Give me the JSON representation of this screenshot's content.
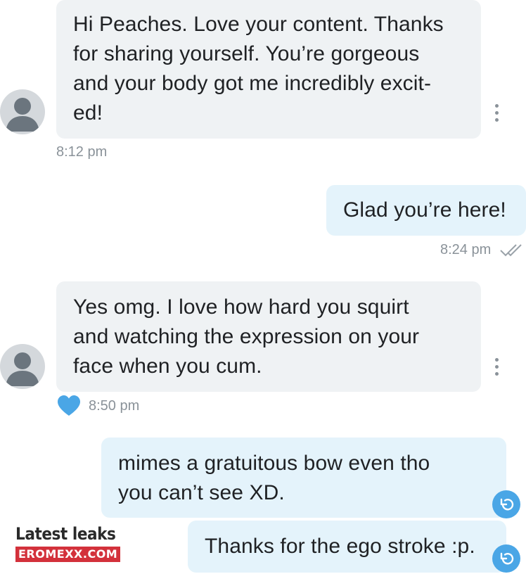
{
  "messages": [
    {
      "direction": "incoming",
      "text": "Hi Peaches. Love your content. Thanks\nfor sharing yourself. You’re gorgeous\nand your body got me incredibly excit-\ned!",
      "time": "8:12 pm"
    },
    {
      "direction": "outgoing",
      "text": "Glad you’re here!",
      "time": "8:24 pm",
      "status_icon": "double-check-icon"
    },
    {
      "direction": "incoming",
      "text": "Yes omg. I love how hard you squirt\nand watching the expression on your\nface when you cum.",
      "time": "8:50 pm",
      "liked": true,
      "like_icon": "heart-icon"
    },
    {
      "direction": "outgoing",
      "text": "mimes a gratuitous bow even tho\nyou can’t see XD.",
      "action_icon": "undo-icon"
    },
    {
      "direction": "outgoing",
      "text": "Thanks for the ego stroke :p.",
      "action_icon": "undo-icon"
    }
  ],
  "watermark": {
    "line1": "Latest leaks",
    "line2": "EROMEXX.COM"
  },
  "colors": {
    "incoming_bubble": "#eff2f4",
    "outgoing_bubble": "#e4f3fb",
    "accent_blue": "#4aa6e6",
    "timestamp": "#8a9299",
    "watermark_red": "#d3313b"
  }
}
